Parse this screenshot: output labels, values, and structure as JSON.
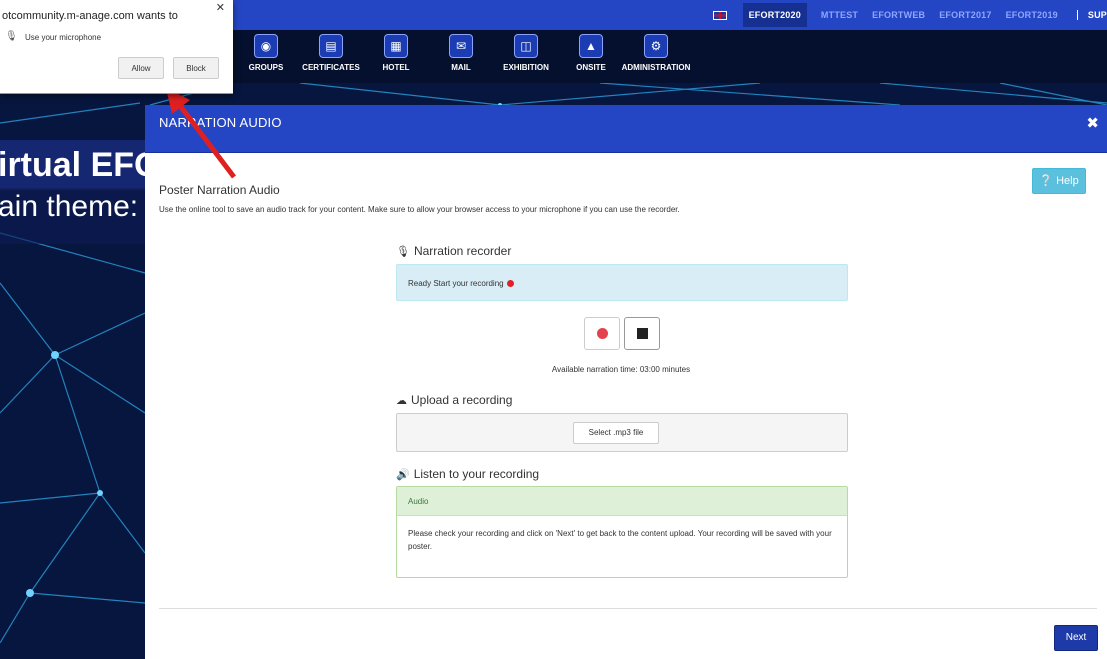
{
  "topbar": {
    "events": [
      "EFORT2020",
      "MTTEST",
      "EFORTWEB",
      "EFORT2017",
      "EFORT2019"
    ],
    "active_event": "EFORT2020",
    "sup_label": "SUP"
  },
  "nav": {
    "items": [
      {
        "label": "GROUPS",
        "icon": "groups-icon"
      },
      {
        "label": "CERTIFICATES",
        "icon": "certificate-icon"
      },
      {
        "label": "HOTEL",
        "icon": "hotel-icon"
      },
      {
        "label": "MAIL",
        "icon": "mail-icon"
      },
      {
        "label": "EXHIBITION",
        "icon": "exhibition-icon"
      },
      {
        "label": "ONSITE",
        "icon": "onsite-icon"
      },
      {
        "label": "ADMINISTRATION",
        "icon": "administration-icon"
      }
    ]
  },
  "hero": {
    "line1": "irtual EFO",
    "line2": "ain theme:"
  },
  "permission": {
    "origin": "otcommunity.m-anage.com wants to",
    "request": "Use your microphone",
    "allow_label": "Allow",
    "block_label": "Block"
  },
  "modal": {
    "title": "NARRATION AUDIO",
    "help_label": "Help",
    "poster_title": "Poster Narration Audio",
    "description": "Use the online tool to save an audio track for your content. Make sure to allow your browser access to your microphone if you can use the recorder.",
    "recorder_title": "Narration recorder",
    "status_text": "Ready Start your recording",
    "available_time": "Available narration time: 03:00 minutes",
    "upload_title": "Upload a recording",
    "select_file_label": "Select .mp3 file",
    "listen_title": "Listen to your recording",
    "audio_heading": "Audio",
    "audio_body": "Please check your recording and click on 'Next' to get back to the content upload. Your recording will be saved with your poster.",
    "next_label": "Next"
  },
  "colors": {
    "brand_blue": "#2546c4",
    "info_bg": "#d9edf7",
    "success_bg": "#dff0d8",
    "record_red": "#e0434f",
    "arrow_red": "#e02020"
  }
}
